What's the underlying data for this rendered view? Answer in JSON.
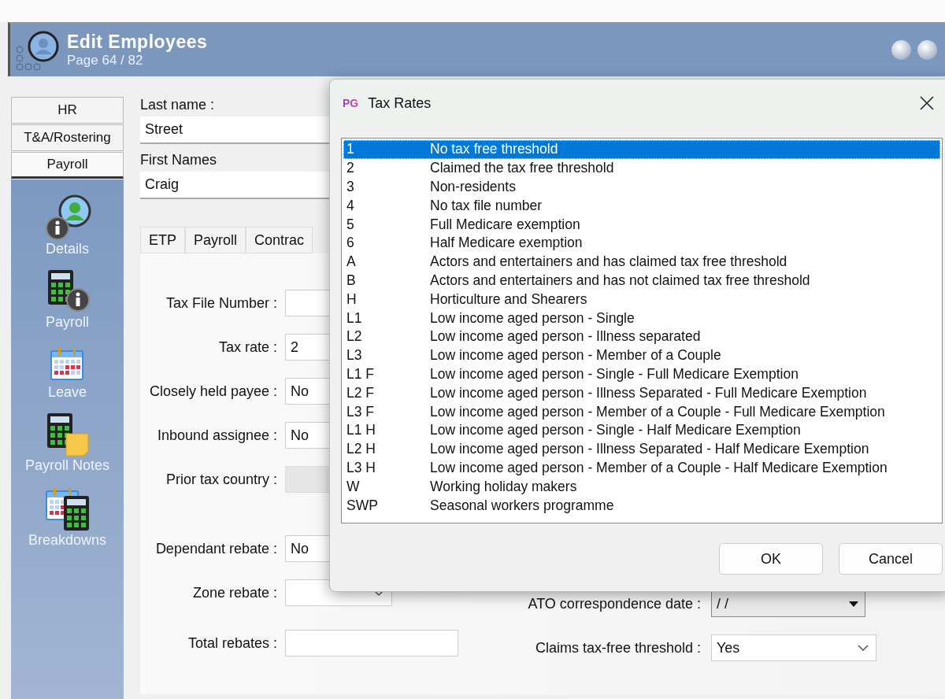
{
  "window": {
    "title": "Edit Employees",
    "subtitle": "Page 64 / 82"
  },
  "sidebar": {
    "tabs": [
      {
        "label": "HR",
        "selected": false
      },
      {
        "label": "T&A/Rostering",
        "selected": false
      },
      {
        "label": "Payroll",
        "selected": true
      }
    ],
    "items": [
      {
        "label": "Details"
      },
      {
        "label": "Payroll"
      },
      {
        "label": "Leave"
      },
      {
        "label": "Payroll Notes"
      },
      {
        "label": "Breakdowns"
      }
    ]
  },
  "name_fields": [
    {
      "label": "Last name :",
      "value": "Street"
    },
    {
      "label": "First Names",
      "value": "Craig"
    }
  ],
  "tabs": [
    {
      "label": "ETP",
      "selected": false
    },
    {
      "label": "Payroll",
      "selected": false
    },
    {
      "label": "Contrac",
      "selected": false
    }
  ],
  "form": {
    "left_upper": [
      {
        "label": "Tax File Number :",
        "disabled": false
      },
      {
        "label": "Tax rate :",
        "value": "2",
        "disabled": false
      },
      {
        "label": "Closely held payee :",
        "value": "No",
        "disabled": false
      },
      {
        "label": "Inbound assignee :",
        "value": "No",
        "disabled": false
      },
      {
        "label": "Prior tax country :",
        "disabled": true
      }
    ],
    "left_lower": [
      {
        "label": "Dependant rebate :",
        "value": "No",
        "disabled": false
      },
      {
        "label": "Zone rebate :",
        "kind": "combo"
      },
      {
        "label": "Total rebates :",
        "disabled": false
      }
    ],
    "right": [
      {
        "label": "ATO correspondence date :",
        "value": "/ /",
        "kind": "date"
      },
      {
        "label": "Claims tax-free threshold :",
        "value": "Yes",
        "kind": "combo"
      }
    ]
  },
  "dialog": {
    "app_icon": "PG",
    "title": "Tax Rates",
    "rates": [
      {
        "code": "1",
        "description": "No tax free threshold",
        "selected": true
      },
      {
        "code": "2",
        "description": "Claimed the tax free threshold",
        "selected": false
      },
      {
        "code": "3",
        "description": "Non-residents",
        "selected": false
      },
      {
        "code": "4",
        "description": "No tax file number",
        "selected": false
      },
      {
        "code": "5",
        "description": "Full Medicare exemption",
        "selected": false
      },
      {
        "code": "6",
        "description": "Half Medicare exemption",
        "selected": false
      },
      {
        "code": "A",
        "description": "Actors and entertainers and has claimed tax free threshold",
        "selected": false
      },
      {
        "code": "B",
        "description": "Actors and entertainers and has not claimed tax free threshold",
        "selected": false
      },
      {
        "code": "H",
        "description": "Horticulture and Shearers",
        "selected": false
      },
      {
        "code": "L1",
        "description": "Low income aged person - Single",
        "selected": false
      },
      {
        "code": "L2",
        "description": "Low income aged person - Illness separated",
        "selected": false
      },
      {
        "code": "L3",
        "description": "Low income aged person - Member of a Couple",
        "selected": false
      },
      {
        "code": "L1 F",
        "description": "Low income aged person - Single - Full Medicare Exemption",
        "selected": false
      },
      {
        "code": "L2 F",
        "description": "Low income aged person - Illness Separated - Full Medicare Exemption",
        "selected": false
      },
      {
        "code": "L3 F",
        "description": "Low income aged person - Member of a Couple - Full Medicare Exemption",
        "selected": false
      },
      {
        "code": "L1 H",
        "description": "Low income aged person - Single - Half Medicare Exemption",
        "selected": false
      },
      {
        "code": "L2 H",
        "description": "Low income aged person - Illness Separated - Half Medicare Exemption",
        "selected": false
      },
      {
        "code": "L3 H",
        "description": "Low income aged person - Member of a Couple - Half Medicare Exemption",
        "selected": false
      },
      {
        "code": "W",
        "description": "Working holiday makers",
        "selected": false
      },
      {
        "code": "SWP",
        "description": "Seasonal workers programme",
        "selected": false
      }
    ],
    "buttons": [
      "OK",
      "Cancel"
    ]
  }
}
